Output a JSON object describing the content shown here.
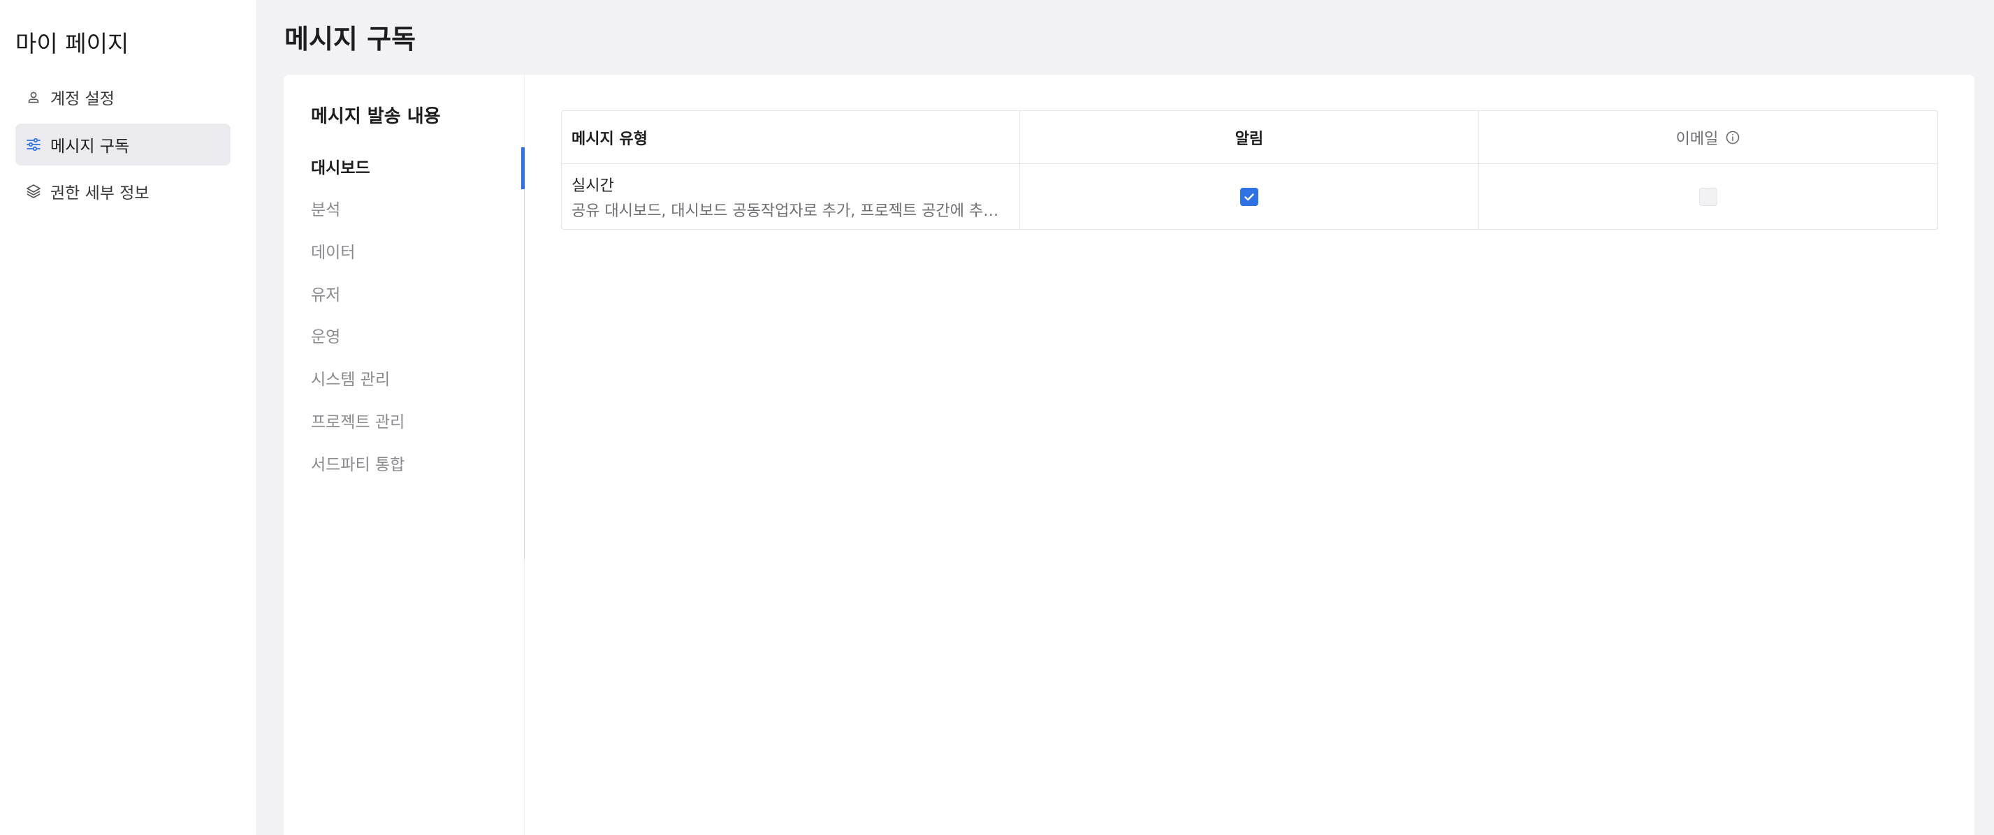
{
  "sidebar": {
    "title": "마이 페이지",
    "items": [
      {
        "label": "계정 설정",
        "icon": "user-icon",
        "active": false
      },
      {
        "label": "메시지 구독",
        "icon": "sliders-icon",
        "active": true
      },
      {
        "label": "권한 세부 정보",
        "icon": "layers-icon",
        "active": false
      }
    ]
  },
  "page": {
    "title": "메시지 구독"
  },
  "subnav": {
    "title": "메시지 발송 내용",
    "items": [
      {
        "label": "대시보드",
        "active": true
      },
      {
        "label": "분석",
        "active": false
      },
      {
        "label": "데이터",
        "active": false
      },
      {
        "label": "유저",
        "active": false
      },
      {
        "label": "운영",
        "active": false
      },
      {
        "label": "시스템 관리",
        "active": false
      },
      {
        "label": "프로젝트 관리",
        "active": false
      },
      {
        "label": "서드파티 통합",
        "active": false
      }
    ]
  },
  "table": {
    "columns": {
      "type": "메시지 유형",
      "notification": "알림",
      "email": "이메일"
    },
    "rows": [
      {
        "name": "실시간",
        "description": "공유 대시보드, 대시보드 공동작업자로 추가, 프로젝트 공간에 추가, ...",
        "notification_checked": true,
        "email_checked": false,
        "email_disabled": true
      }
    ]
  },
  "colors": {
    "accent": "#2f72e4",
    "background": "#f2f2f4",
    "active_item_bg": "#ebebef"
  }
}
